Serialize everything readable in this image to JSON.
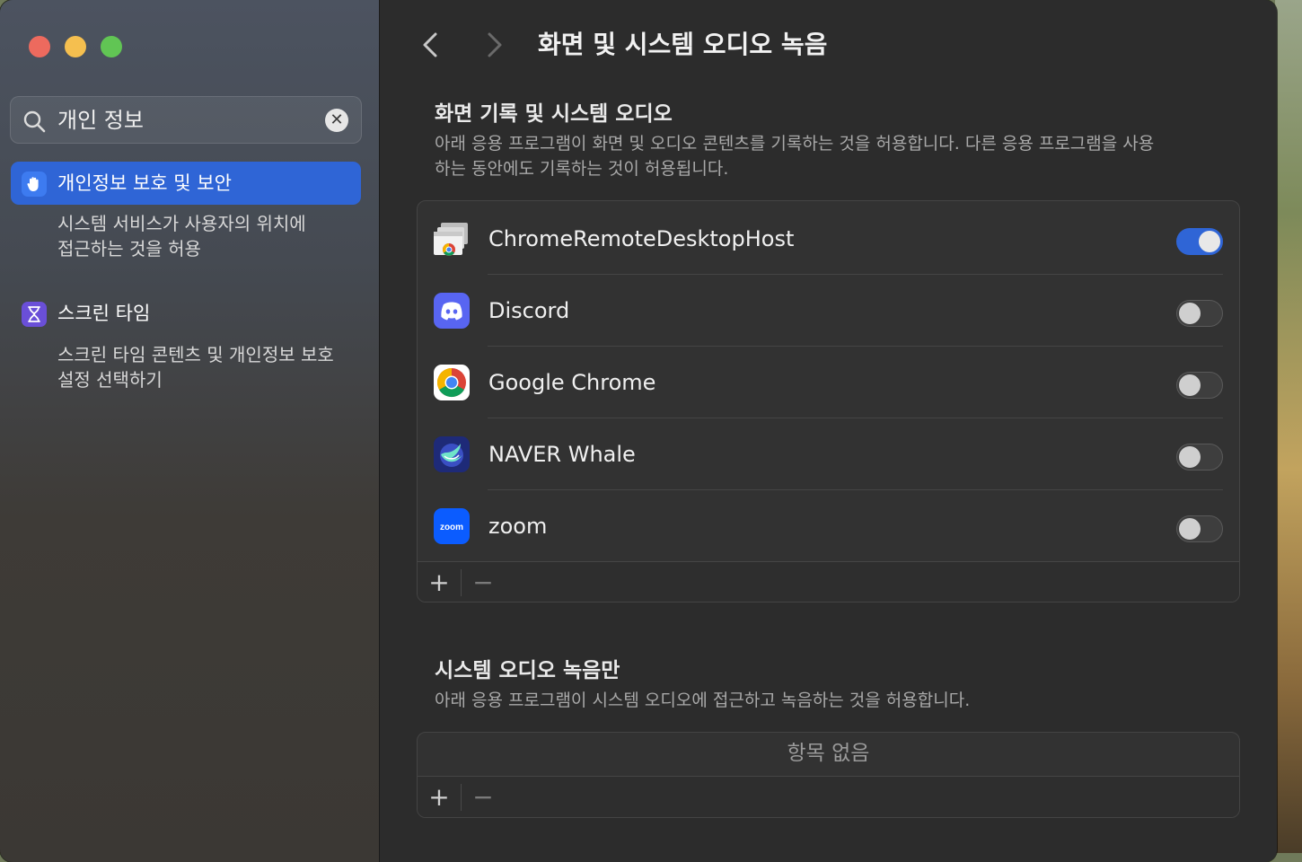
{
  "window": {
    "title": "화면 및 시스템 오디오 녹음"
  },
  "search": {
    "query": "개인 정보"
  },
  "sidebar": {
    "items": [
      {
        "label": "개인정보 보호 및 보안",
        "sub": [
          "시스템 서비스가 사용자의 위치에",
          "접근하는 것을 허용"
        ],
        "selected": true,
        "icon": "hand-icon"
      },
      {
        "label": "스크린 타임",
        "sub": [
          "스크린 타임 콘텐츠 및 개인정보 보호",
          "설정 선택하기"
        ],
        "selected": false,
        "icon": "hourglass-icon"
      }
    ]
  },
  "section1": {
    "title": "화면 기록 및 시스템 오디오",
    "desc": [
      "아래 응용 프로그램이 화면 및 오디오 콘텐츠를 기록하는 것을 허용합니다. 다른 응용 프로그램을 사용",
      "하는 동안에도 기록하는 것이 허용됩니다."
    ],
    "apps": [
      {
        "name": "ChromeRemoteDesktopHost",
        "enabled": true,
        "icon": "chrome-remote-desktop-icon"
      },
      {
        "name": "Discord",
        "enabled": false,
        "icon": "discord-icon"
      },
      {
        "name": "Google Chrome",
        "enabled": false,
        "icon": "chrome-icon"
      },
      {
        "name": "NAVER Whale",
        "enabled": false,
        "icon": "whale-icon"
      },
      {
        "name": "zoom",
        "enabled": false,
        "icon": "zoom-icon",
        "icon_text": "zoom"
      }
    ],
    "add_label": "+",
    "remove_label": "−"
  },
  "section2": {
    "title": "시스템 오디오 녹음만",
    "desc": "아래 응용 프로그램이 시스템 오디오에 접근하고 녹음하는 것을 허용합니다.",
    "empty_text": "항목 없음",
    "add_label": "+",
    "remove_label": "−"
  },
  "colors": {
    "accent": "#2f65d6",
    "close": "#ed6a5e",
    "minimize": "#f5bf4f",
    "maximize": "#61c554"
  }
}
